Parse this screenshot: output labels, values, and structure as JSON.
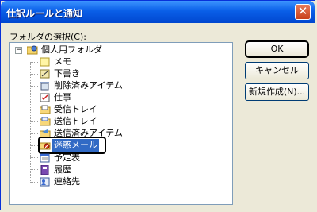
{
  "window": {
    "title": "仕訳ルールと通知",
    "close_glyph": "✕"
  },
  "folder_select_label": "フォルダの選択(C):",
  "tree": {
    "root": {
      "label": "個人用フォルダ",
      "icon": "personal-folders-icon",
      "expander": "⊟"
    },
    "items": [
      {
        "label": "メモ",
        "icon": "notes-icon"
      },
      {
        "label": "下書き",
        "icon": "drafts-icon"
      },
      {
        "label": "削除済みアイテム",
        "icon": "deleted-items-icon"
      },
      {
        "label": "仕事",
        "icon": "tasks-icon"
      },
      {
        "label": "受信トレイ",
        "icon": "inbox-icon"
      },
      {
        "label": "送信トレイ",
        "icon": "outbox-icon"
      },
      {
        "label": "送信済みアイテム",
        "icon": "sent-items-icon"
      },
      {
        "label": "迷惑メール",
        "icon": "junk-mail-icon",
        "selected": true
      },
      {
        "label": "予定表",
        "icon": "calendar-icon"
      },
      {
        "label": "履歴",
        "icon": "journal-icon"
      },
      {
        "label": "連絡先",
        "icon": "contacts-icon"
      }
    ]
  },
  "buttons": {
    "ok": "OK",
    "cancel": "キャンセル",
    "new_folder": "新規作成(N)..."
  },
  "colors": {
    "title_bar": "#0a5fe8",
    "selection": "#316ac5",
    "dialog_bg": "#ece9d8"
  }
}
